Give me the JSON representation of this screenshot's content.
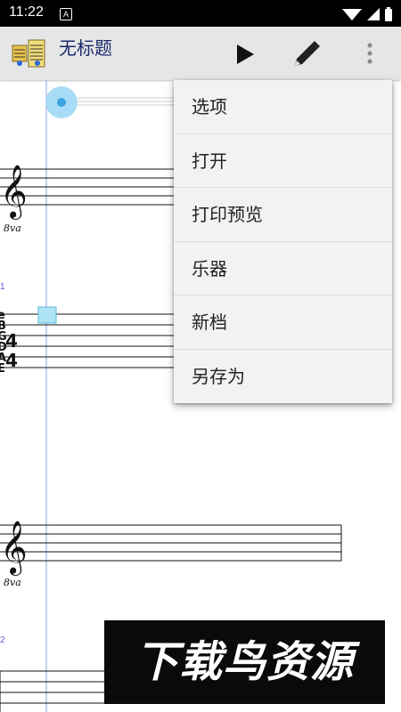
{
  "status_bar": {
    "time": "11:22",
    "notification_badge": "A"
  },
  "toolbar": {
    "title": "无标题",
    "icons": [
      "app-logo-icon",
      "play-icon",
      "pencil-icon",
      "overflow-menu-icon"
    ]
  },
  "menu": {
    "items": [
      {
        "label": "选项"
      },
      {
        "label": "打开"
      },
      {
        "label": "打印预览"
      },
      {
        "label": "乐器"
      },
      {
        "label": "新档"
      },
      {
        "label": "另存为"
      }
    ]
  },
  "score": {
    "measure_numbers": [
      "1",
      "2"
    ],
    "octave_marking": "8va",
    "tab_strings": [
      "e",
      "B",
      "G",
      "D",
      "A",
      "E"
    ],
    "time_signature": [
      "4",
      "4"
    ]
  },
  "watermark": {
    "text": "下载鸟资源"
  },
  "colors": {
    "toolbar_bg": "#e6e6e6",
    "cursor_blue": "#64c8f0",
    "measure_number": "#5a5ad8",
    "menu_bg": "#f2f2f2"
  }
}
